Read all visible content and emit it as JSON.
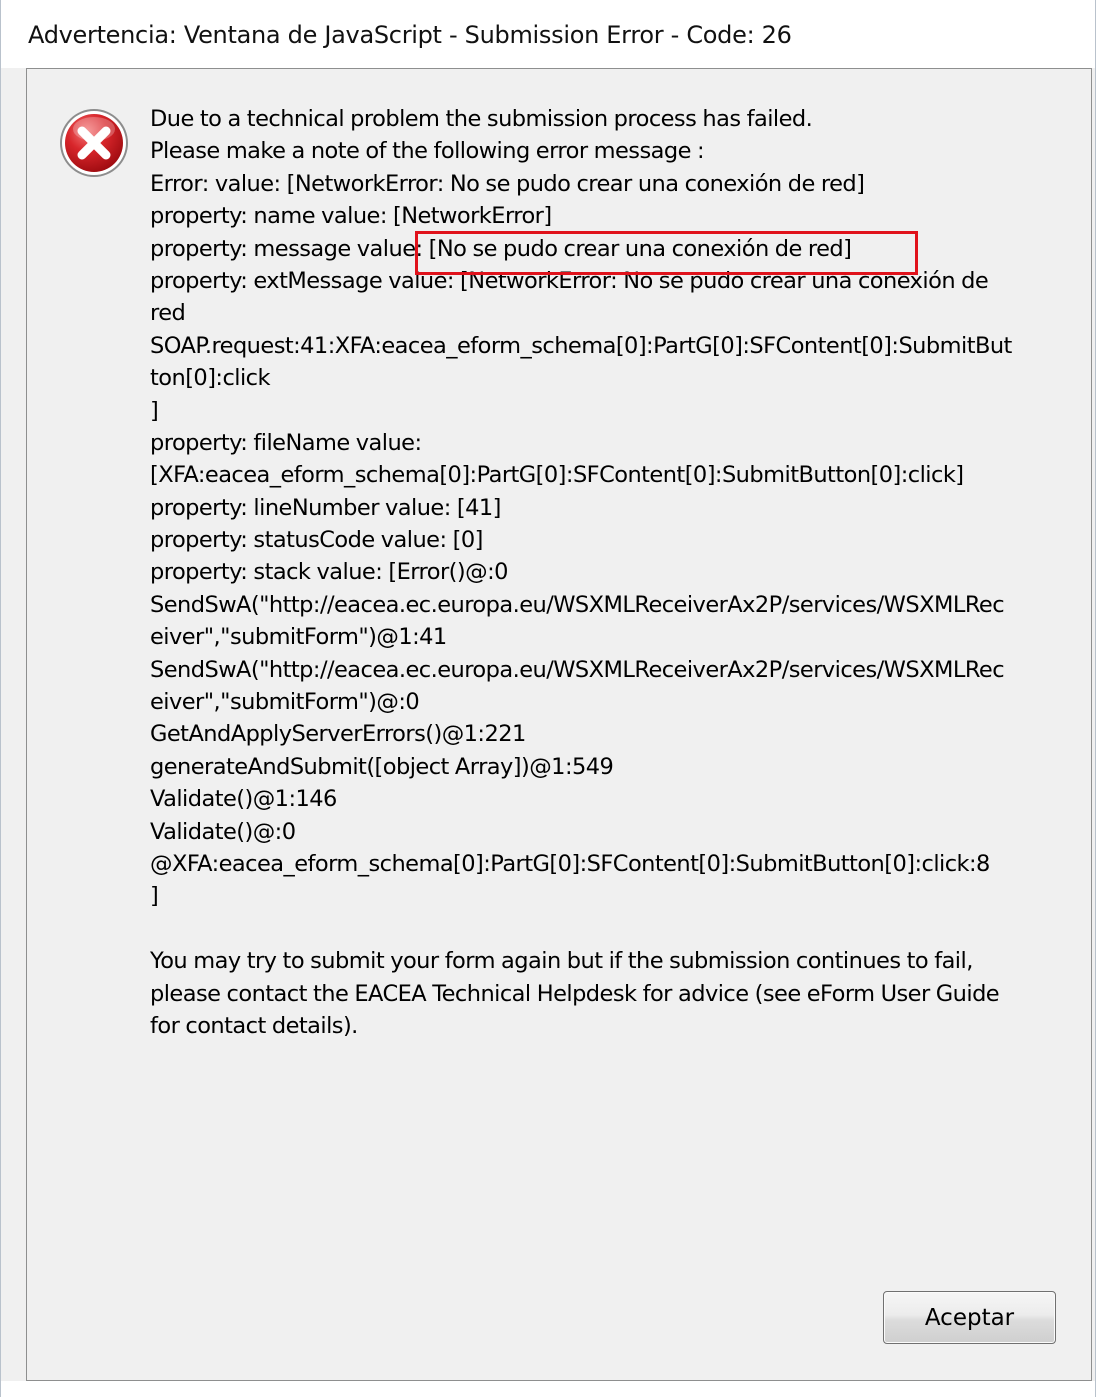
{
  "window": {
    "title": "Advertencia: Ventana de JavaScript - Submission Error - Code: 26"
  },
  "icon": {
    "name": "error-icon",
    "color": "#c8121b"
  },
  "message": {
    "lines": [
      "Due to a technical problem the submission process has failed.",
      "Please make a note of the following error message :",
      "Error:  value: [NetworkError: No se pudo crear una conexión de red]",
      "property: name value: [NetworkError]",
      "property: message value: [No se pudo crear una conexión de red]",
      "property: extMessage value: [NetworkError: No se pudo crear una conexión de",
      "red",
      "SOAP.request:41:XFA:eacea_eform_schema[0]:PartG[0]:SFContent[0]:SubmitBut",
      "ton[0]:click",
      "]",
      "property: fileName value:",
      "[XFA:eacea_eform_schema[0]:PartG[0]:SFContent[0]:SubmitButton[0]:click]",
      "property: lineNumber value: [41]",
      "property: statusCode value: [0]",
      "property: stack value: [Error()@:0",
      "SendSwA(\"http://eacea.ec.europa.eu/WSXMLReceiverAx2P/services/WSXMLRec",
      "eiver\",\"submitForm\")@1:41",
      "SendSwA(\"http://eacea.ec.europa.eu/WSXMLReceiverAx2P/services/WSXMLRec",
      "eiver\",\"submitForm\")@:0",
      "GetAndApplyServerErrors()@1:221",
      "generateAndSubmit([object Array])@1:549",
      "Validate()@1:146",
      "Validate()@:0",
      "@XFA:eacea_eform_schema[0]:PartG[0]:SFContent[0]:SubmitButton[0]:click:8",
      "]",
      "",
      "You may try to submit your form again but if the submission continues to fail,",
      "please contact the EACEA Technical Helpdesk for advice (see eForm User Guide",
      "for contact details)."
    ]
  },
  "buttons": {
    "ok_label": "Aceptar"
  },
  "annotation": {
    "highlight_color": "#e0121b"
  }
}
